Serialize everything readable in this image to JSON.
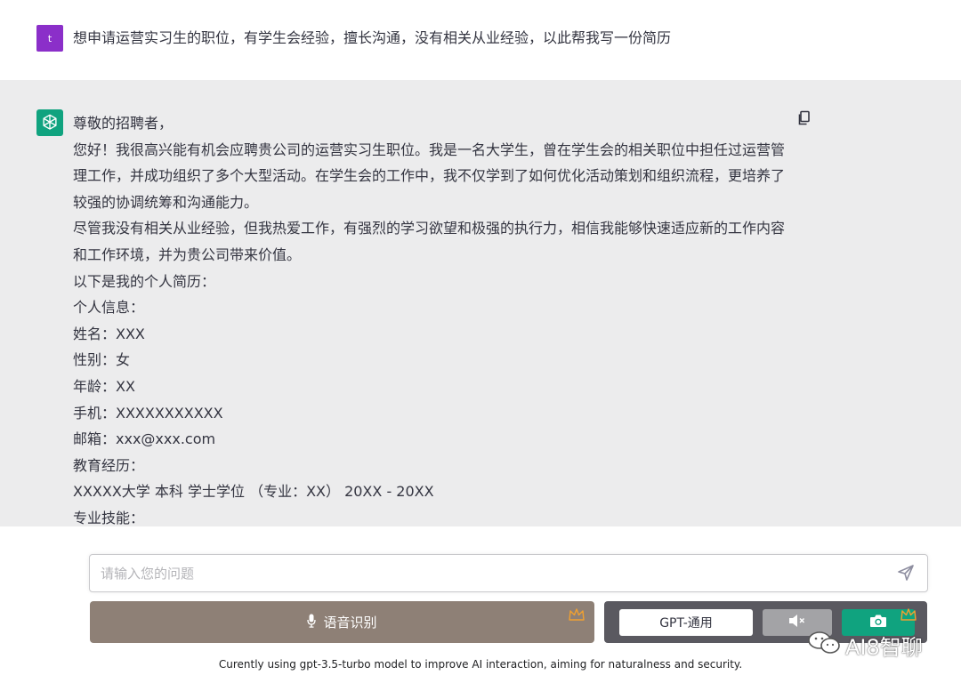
{
  "user_message": {
    "avatar_letter": "t",
    "text": "想申请运营实习生的职位，有学生会经验，擅长沟通，没有相关从业经验，以此帮我写一份简历"
  },
  "assistant_message": {
    "lines": [
      "尊敬的招聘者，",
      "您好！我很高兴能有机会应聘贵公司的运营实习生职位。我是一名大学生，曾在学生会的相关职位中担任过运营管理工作，并成功组织了多个大型活动。在学生会的工作中，我不仅学到了如何优化活动策划和组织流程，更培养了较强的协调统筹和沟通能力。",
      "尽管我没有相关从业经验，但我热爱工作，有强烈的学习欲望和极强的执行力，相信我能够快速适应新的工作内容和工作环境，并为贵公司带来价值。",
      "以下是我的个人简历：",
      "个人信息：",
      "姓名：XXX",
      "性别：女",
      "年龄：XX",
      "手机：XXXXXXXXXXX",
      "邮箱：xxx@xxx.com",
      "教育经历：",
      "XXXXX大学 本科 学士学位 （专业：XX） 20XX - 20XX",
      "专业技能："
    ]
  },
  "composer": {
    "placeholder": "请输入您的问题",
    "voice_label": "语音识别",
    "model_label": "GPT-通用"
  },
  "footer": {
    "note": "Curently using gpt-3.5-turbo model to improve AI interaction, aiming for naturalness and security."
  },
  "watermark": {
    "text": "AI8智聊"
  },
  "colors": {
    "user_avatar": "#8b2fc9",
    "assistant_avatar": "#10a37f",
    "assistant_bg": "#ececed",
    "voice_button": "#8e8076",
    "tools_bar": "#5a5960",
    "camera_button": "#10a37f",
    "crown": "#f0a030"
  },
  "icons": {
    "assistant_avatar": "openai-logo-icon",
    "copy": "copy-icon",
    "send": "send-icon",
    "voice": "microphone-icon",
    "mute": "speaker-muted-icon",
    "camera": "camera-icon",
    "vip": "crown-icon",
    "watermark": "wechat-icon"
  }
}
